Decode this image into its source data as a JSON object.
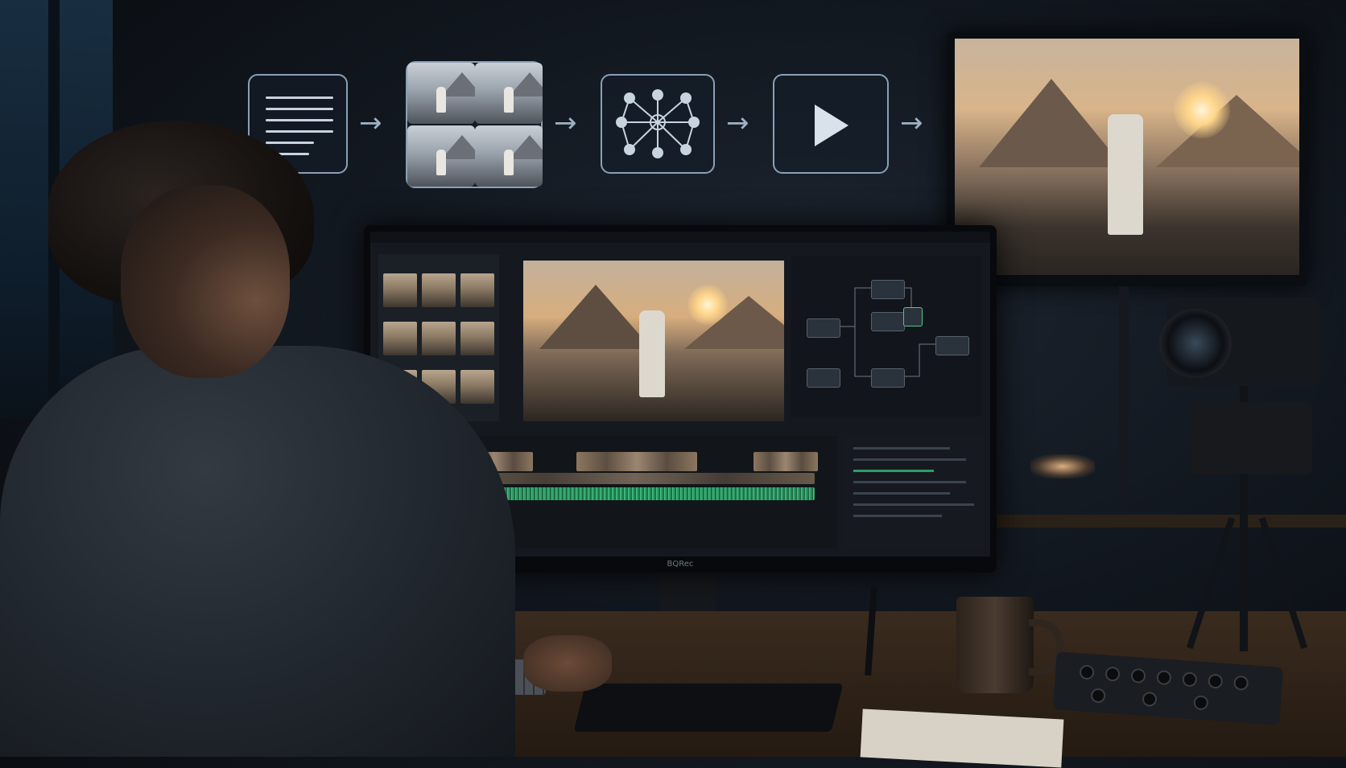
{
  "scene": {
    "description_free": true
  },
  "pipeline": {
    "steps": [
      {
        "icon": "document-icon"
      },
      {
        "icon": "image-grid-icon"
      },
      {
        "icon": "network-icon"
      },
      {
        "icon": "play-icon"
      }
    ],
    "arrow_glyph": "→"
  },
  "monitor": {
    "brand_label": "BQRec"
  },
  "colors": {
    "accent_green": "#3cc27f",
    "pipeline_border": "#8aa0b4"
  }
}
